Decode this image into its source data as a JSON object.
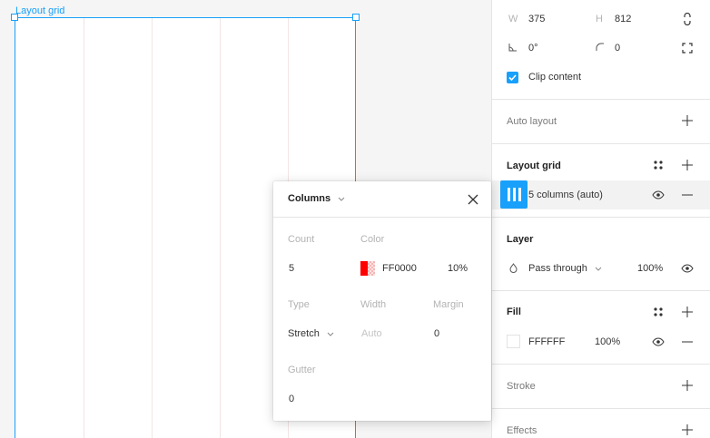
{
  "canvas": {
    "frame_label": "Layout grid",
    "grid_color": "#f3e4e4",
    "selection_color": "#18a0fb"
  },
  "panel": {
    "dims": {
      "w_label": "W",
      "w_value": "375",
      "h_label": "H",
      "h_value": "812"
    },
    "transform": {
      "rotation": "0°",
      "radius": "0"
    },
    "clip_content": {
      "label": "Clip content",
      "checked": true
    },
    "auto_layout": {
      "title": "Auto layout"
    },
    "layout_grid": {
      "title": "Layout grid",
      "item_label": "5 columns (auto)"
    },
    "layer": {
      "title": "Layer",
      "blend_mode": "Pass through",
      "opacity": "100%"
    },
    "fill": {
      "title": "Fill",
      "hex": "FFFFFF",
      "opacity": "100%"
    },
    "stroke": {
      "title": "Stroke"
    },
    "effects": {
      "title": "Effects"
    }
  },
  "popup": {
    "title": "Columns",
    "count_label": "Count",
    "count_value": "5",
    "color_label": "Color",
    "color_hex": "FF0000",
    "color_opacity": "10%",
    "type_label": "Type",
    "type_value": "Stretch",
    "width_label": "Width",
    "width_placeholder": "Auto",
    "margin_label": "Margin",
    "margin_value": "0",
    "gutter_label": "Gutter",
    "gutter_value": "0"
  },
  "colors": {
    "accent": "#18a0fb",
    "grid_red": "#ff0000"
  },
  "icons": [
    "constrain-proportions-icon",
    "rotation-icon",
    "corner-radius-icon",
    "independent-corners-icon",
    "check-icon",
    "plus-icon",
    "minus-icon",
    "grid-style-icon",
    "column-grid-icon",
    "eye-icon",
    "blend-drop-icon",
    "chevron-down-icon",
    "close-icon"
  ]
}
